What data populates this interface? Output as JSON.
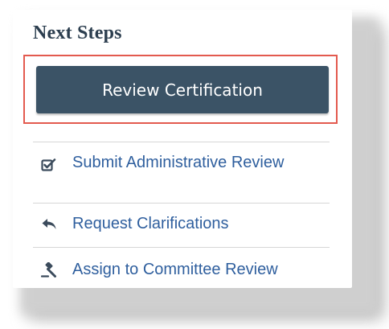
{
  "panel": {
    "title": "Next Steps",
    "primary_action": {
      "label": "Review Certification",
      "highlighted": true
    },
    "steps": [
      {
        "label": "Submit Administrative Review",
        "icon": "checkbox-edit-icon"
      },
      {
        "label": "Request Clarifications",
        "icon": "reply-arrow-icon"
      },
      {
        "label": "Assign to Committee Review",
        "icon": "gavel-icon"
      }
    ]
  },
  "colors": {
    "button_bg": "#3b5366",
    "highlight_border": "#e35a4f",
    "link_text": "#2f5f9e",
    "title_text": "#2c3e4f"
  }
}
